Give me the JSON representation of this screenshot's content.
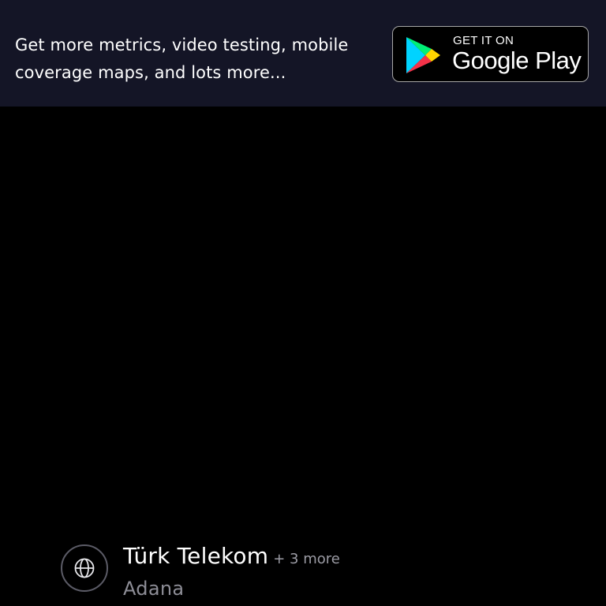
{
  "promo": {
    "line1": "Get more metrics, video testing, mobile",
    "line2": "coverage maps, and lots more...",
    "badge": {
      "small_text": "GET IT ON",
      "large_text": "Google Play",
      "logo_icon": "google-play-icon"
    }
  },
  "provider": {
    "name": "Türk Telekom",
    "more": "+ 3 more",
    "location": "Adana",
    "icon": "globe-icon"
  },
  "colors": {
    "banner_bg": "#141526",
    "page_bg": "#000000",
    "text_primary": "#ffffff",
    "text_secondary": "#8d8d96"
  }
}
